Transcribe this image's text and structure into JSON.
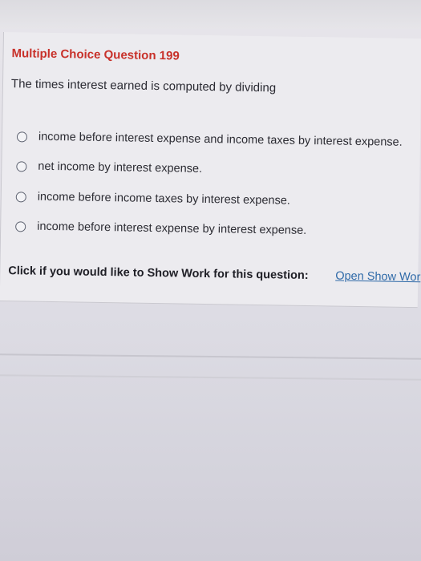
{
  "question": {
    "title": "Multiple Choice Question 199",
    "prompt": "The times interest earned is computed by dividing",
    "options": [
      "income before interest expense and income taxes by interest expense.",
      "net income by interest expense.",
      "income before income taxes by interest expense.",
      "income before interest expense by interest expense."
    ]
  },
  "show_work": {
    "label": "Click if you would like to Show Work for this question:",
    "link": "Open Show Wor"
  },
  "colors": {
    "title": "#c8312a",
    "link": "#2f6aa8"
  }
}
